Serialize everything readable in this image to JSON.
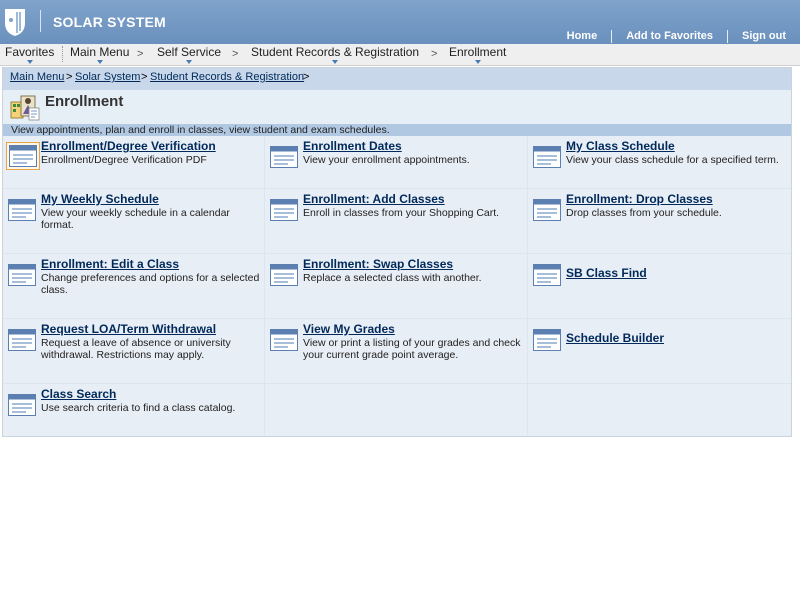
{
  "header": {
    "app_title": "SOLAR SYSTEM",
    "links": [
      "Home",
      "Add to Favorites",
      "Sign out"
    ]
  },
  "nav": {
    "items": [
      "Favorites",
      "Main Menu",
      "Self Service",
      "Student Records & Registration",
      "Enrollment"
    ],
    "chevron": ">"
  },
  "breadcrumb": {
    "items": [
      "Main Menu",
      "Solar System",
      "Student Records & Registration"
    ],
    "sep": ">"
  },
  "page": {
    "title": "Enrollment",
    "description": "View appointments, plan and enroll in classes, view student and exam schedules."
  },
  "colors": {
    "header": "#7fa3cb",
    "link": "#00295a",
    "cell_bg": "#e8eef5",
    "desc_band": "#b0c8e2"
  },
  "tiles": [
    {
      "title": "Enrollment/Degree Verification",
      "desc": "Enrollment/Degree Verification PDF"
    },
    {
      "title": "Enrollment Dates",
      "desc": "View your enrollment appointments."
    },
    {
      "title": "My Class Schedule",
      "desc": "View your class schedule for a specified term."
    },
    {
      "title": "My Weekly Schedule",
      "desc": "View your weekly schedule in a calendar format."
    },
    {
      "title": "Enrollment: Add Classes",
      "desc": "Enroll in classes from your Shopping Cart."
    },
    {
      "title": "Enrollment: Drop Classes",
      "desc": "Drop classes from your schedule."
    },
    {
      "title": "Enrollment: Edit a Class",
      "desc": "Change preferences and options for a selected class."
    },
    {
      "title": "Enrollment: Swap Classes",
      "desc": "Replace a selected class with another."
    },
    {
      "title": "SB Class Find",
      "desc": ""
    },
    {
      "title": "Request LOA/Term Withdrawal",
      "desc": "Request a leave of absence or university withdrawal. Restrictions may apply."
    },
    {
      "title": "View My Grades",
      "desc": "View or print a listing of your grades and check your current grade point average."
    },
    {
      "title": "Schedule Builder",
      "desc": ""
    },
    {
      "title": "Class Search",
      "desc": "Use search criteria to find a class catalog."
    }
  ]
}
